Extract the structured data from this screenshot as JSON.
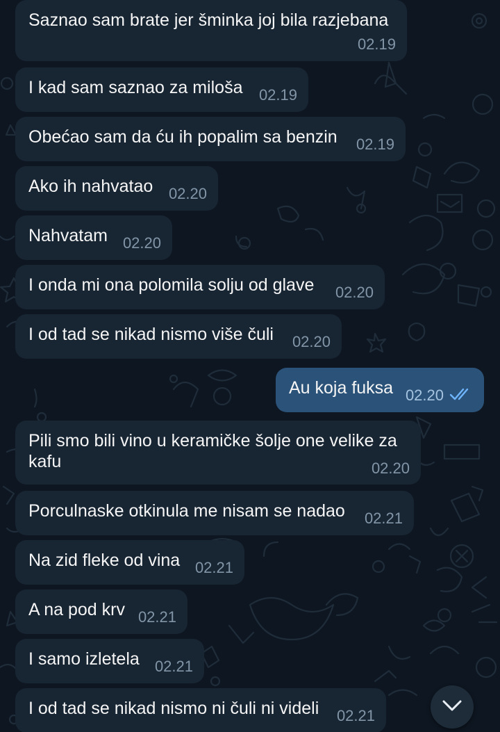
{
  "messages": [
    {
      "text": "Saznao sam brate jer šminka joj bila razjebana",
      "time": "02.19",
      "outgoing": false
    },
    {
      "text": "I kad sam saznao za miloša",
      "time": "02.19",
      "outgoing": false
    },
    {
      "text": "Obećao sam da ću ih popalim sa benzin",
      "time": "02.19",
      "outgoing": false
    },
    {
      "text": "Ako ih nahvatao",
      "time": "02.20",
      "outgoing": false
    },
    {
      "text": "Nahvatam",
      "time": "02.20",
      "outgoing": false
    },
    {
      "text": "I onda mi ona polomila solju od glave",
      "time": "02.20",
      "outgoing": false
    },
    {
      "text": "I od tad se nikad nismo više čuli",
      "time": "02.20",
      "outgoing": false
    },
    {
      "text": "Au koja fuksa",
      "time": "02.20",
      "outgoing": true,
      "status": "read"
    },
    {
      "text": "Pili smo bili vino u keramičke šolje one velike za kafu",
      "time": "02.20",
      "outgoing": false
    },
    {
      "text": "Porculnaske otkinula me nisam se nadao",
      "time": "02.21",
      "outgoing": false
    },
    {
      "text": "Na zid fleke od vina",
      "time": "02.21",
      "outgoing": false
    },
    {
      "text": "A na pod krv",
      "time": "02.21",
      "outgoing": false
    },
    {
      "text": "I samo izletela",
      "time": "02.21",
      "outgoing": false
    },
    {
      "text": "I od tad se nikad nismo ni čuli ni videli",
      "time": "02.21",
      "outgoing": false
    }
  ],
  "colors": {
    "background": "#0e1621",
    "incoming_bubble": "#182533",
    "outgoing_bubble": "#2b5278",
    "read_ticks": "#6fb6ff"
  },
  "scroll_button": {
    "icon": "chevron-down-icon"
  }
}
